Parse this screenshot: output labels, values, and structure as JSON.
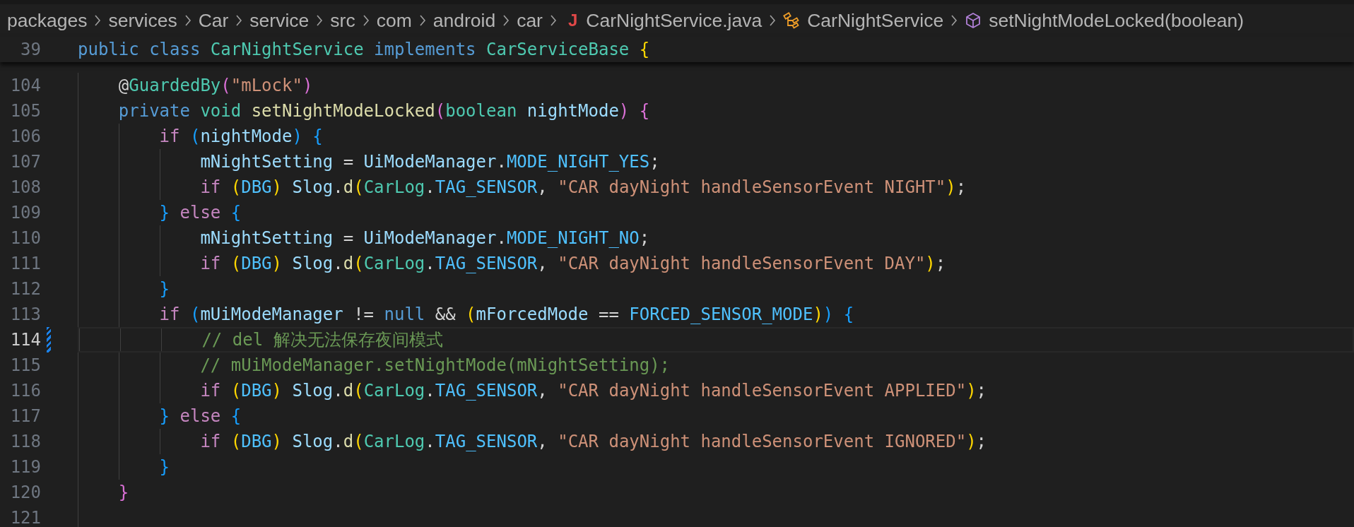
{
  "breadcrumbs": [
    {
      "kind": "folder",
      "label": "packages"
    },
    {
      "kind": "folder",
      "label": "services"
    },
    {
      "kind": "folder",
      "label": "Car"
    },
    {
      "kind": "folder",
      "label": "service"
    },
    {
      "kind": "folder",
      "label": "src"
    },
    {
      "kind": "folder",
      "label": "com"
    },
    {
      "kind": "folder",
      "label": "android"
    },
    {
      "kind": "folder",
      "label": "car"
    },
    {
      "kind": "file",
      "icon_text": "J",
      "label": "CarNightService.java"
    },
    {
      "kind": "class",
      "label": "CarNightService"
    },
    {
      "kind": "method",
      "label": "setNightModeLocked(boolean)"
    }
  ],
  "sticky_line": {
    "number": "39",
    "tokens": [
      {
        "kind": "keyword",
        "text": "public"
      },
      {
        "kind": "keyword",
        "text": " class"
      },
      {
        "kind": "type",
        "text": " CarNightService"
      },
      {
        "kind": "keyword",
        "text": " implements"
      },
      {
        "kind": "type",
        "text": " CarServiceBase"
      },
      {
        "kind": "bracket1",
        "text": " {"
      }
    ]
  },
  "lines": [
    {
      "number": "104",
      "current": false,
      "modified": false,
      "tokens": [
        {
          "kind": "plain",
          "text": "    @"
        },
        {
          "kind": "type",
          "text": "GuardedBy"
        },
        {
          "kind": "bracket2",
          "text": "("
        },
        {
          "kind": "string",
          "text": "\"mLock\""
        },
        {
          "kind": "bracket2",
          "text": ")"
        }
      ]
    },
    {
      "number": "105",
      "current": false,
      "modified": false,
      "tokens": [
        {
          "kind": "keyword",
          "text": "    private"
        },
        {
          "kind": "type",
          "text": " void"
        },
        {
          "kind": "function",
          "text": " setNightModeLocked"
        },
        {
          "kind": "bracket2",
          "text": "("
        },
        {
          "kind": "type",
          "text": "boolean"
        },
        {
          "kind": "variable",
          "text": " nightMode"
        },
        {
          "kind": "bracket2",
          "text": ")"
        },
        {
          "kind": "bracket2",
          "text": " {"
        }
      ]
    },
    {
      "number": "106",
      "current": false,
      "modified": false,
      "tokens": [
        {
          "kind": "control",
          "text": "        if"
        },
        {
          "kind": "bracket3",
          "text": " ("
        },
        {
          "kind": "variable",
          "text": "nightMode"
        },
        {
          "kind": "bracket3",
          "text": ")"
        },
        {
          "kind": "bracket3",
          "text": " {"
        }
      ]
    },
    {
      "number": "107",
      "current": false,
      "modified": false,
      "tokens": [
        {
          "kind": "variable",
          "text": "            mNightSetting"
        },
        {
          "kind": "plain",
          "text": " = "
        },
        {
          "kind": "variable",
          "text": "UiModeManager"
        },
        {
          "kind": "plain",
          "text": "."
        },
        {
          "kind": "constant",
          "text": "MODE_NIGHT_YES"
        },
        {
          "kind": "plain",
          "text": ";"
        }
      ]
    },
    {
      "number": "108",
      "current": false,
      "modified": false,
      "tokens": [
        {
          "kind": "control",
          "text": "            if"
        },
        {
          "kind": "bracket1",
          "text": " ("
        },
        {
          "kind": "constant",
          "text": "DBG"
        },
        {
          "kind": "bracket1",
          "text": ")"
        },
        {
          "kind": "variable",
          "text": " Slog"
        },
        {
          "kind": "plain",
          "text": "."
        },
        {
          "kind": "function",
          "text": "d"
        },
        {
          "kind": "bracket1",
          "text": "("
        },
        {
          "kind": "type",
          "text": "CarLog"
        },
        {
          "kind": "plain",
          "text": "."
        },
        {
          "kind": "constant",
          "text": "TAG_SENSOR"
        },
        {
          "kind": "plain",
          "text": ","
        },
        {
          "kind": "string",
          "text": " \"CAR dayNight handleSensorEvent NIGHT\""
        },
        {
          "kind": "bracket1",
          "text": ")"
        },
        {
          "kind": "plain",
          "text": ";"
        }
      ]
    },
    {
      "number": "109",
      "current": false,
      "modified": false,
      "tokens": [
        {
          "kind": "bracket3",
          "text": "        }"
        },
        {
          "kind": "control",
          "text": " else"
        },
        {
          "kind": "bracket3",
          "text": " {"
        }
      ]
    },
    {
      "number": "110",
      "current": false,
      "modified": false,
      "tokens": [
        {
          "kind": "variable",
          "text": "            mNightSetting"
        },
        {
          "kind": "plain",
          "text": " = "
        },
        {
          "kind": "variable",
          "text": "UiModeManager"
        },
        {
          "kind": "plain",
          "text": "."
        },
        {
          "kind": "constant",
          "text": "MODE_NIGHT_NO"
        },
        {
          "kind": "plain",
          "text": ";"
        }
      ]
    },
    {
      "number": "111",
      "current": false,
      "modified": false,
      "tokens": [
        {
          "kind": "control",
          "text": "            if"
        },
        {
          "kind": "bracket1",
          "text": " ("
        },
        {
          "kind": "constant",
          "text": "DBG"
        },
        {
          "kind": "bracket1",
          "text": ")"
        },
        {
          "kind": "variable",
          "text": " Slog"
        },
        {
          "kind": "plain",
          "text": "."
        },
        {
          "kind": "function",
          "text": "d"
        },
        {
          "kind": "bracket1",
          "text": "("
        },
        {
          "kind": "type",
          "text": "CarLog"
        },
        {
          "kind": "plain",
          "text": "."
        },
        {
          "kind": "constant",
          "text": "TAG_SENSOR"
        },
        {
          "kind": "plain",
          "text": ","
        },
        {
          "kind": "string",
          "text": " \"CAR dayNight handleSensorEvent DAY\""
        },
        {
          "kind": "bracket1",
          "text": ")"
        },
        {
          "kind": "plain",
          "text": ";"
        }
      ]
    },
    {
      "number": "112",
      "current": false,
      "modified": false,
      "tokens": [
        {
          "kind": "bracket3",
          "text": "        }"
        }
      ]
    },
    {
      "number": "113",
      "current": false,
      "modified": false,
      "tokens": [
        {
          "kind": "control",
          "text": "        if"
        },
        {
          "kind": "bracket3",
          "text": " ("
        },
        {
          "kind": "variable",
          "text": "mUiModeManager"
        },
        {
          "kind": "plain",
          "text": " != "
        },
        {
          "kind": "keyword",
          "text": "null"
        },
        {
          "kind": "plain",
          "text": " && "
        },
        {
          "kind": "bracket1",
          "text": "("
        },
        {
          "kind": "variable",
          "text": "mForcedMode"
        },
        {
          "kind": "plain",
          "text": " == "
        },
        {
          "kind": "constant",
          "text": "FORCED_SENSOR_MODE"
        },
        {
          "kind": "bracket1",
          "text": ")"
        },
        {
          "kind": "bracket3",
          "text": ")"
        },
        {
          "kind": "bracket3",
          "text": " {"
        }
      ]
    },
    {
      "number": "114",
      "current": true,
      "modified": true,
      "tokens": [
        {
          "kind": "comment",
          "text": "            // del 解决无法保存夜间模式"
        }
      ]
    },
    {
      "number": "115",
      "current": false,
      "modified": false,
      "tokens": [
        {
          "kind": "comment",
          "text": "            // mUiModeManager.setNightMode(mNightSetting);"
        }
      ]
    },
    {
      "number": "116",
      "current": false,
      "modified": false,
      "tokens": [
        {
          "kind": "control",
          "text": "            if"
        },
        {
          "kind": "bracket1",
          "text": " ("
        },
        {
          "kind": "constant",
          "text": "DBG"
        },
        {
          "kind": "bracket1",
          "text": ")"
        },
        {
          "kind": "variable",
          "text": " Slog"
        },
        {
          "kind": "plain",
          "text": "."
        },
        {
          "kind": "function",
          "text": "d"
        },
        {
          "kind": "bracket1",
          "text": "("
        },
        {
          "kind": "type",
          "text": "CarLog"
        },
        {
          "kind": "plain",
          "text": "."
        },
        {
          "kind": "constant",
          "text": "TAG_SENSOR"
        },
        {
          "kind": "plain",
          "text": ","
        },
        {
          "kind": "string",
          "text": " \"CAR dayNight handleSensorEvent APPLIED\""
        },
        {
          "kind": "bracket1",
          "text": ")"
        },
        {
          "kind": "plain",
          "text": ";"
        }
      ]
    },
    {
      "number": "117",
      "current": false,
      "modified": false,
      "tokens": [
        {
          "kind": "bracket3",
          "text": "        }"
        },
        {
          "kind": "control",
          "text": " else"
        },
        {
          "kind": "bracket3",
          "text": " {"
        }
      ]
    },
    {
      "number": "118",
      "current": false,
      "modified": false,
      "tokens": [
        {
          "kind": "control",
          "text": "            if"
        },
        {
          "kind": "bracket1",
          "text": " ("
        },
        {
          "kind": "constant",
          "text": "DBG"
        },
        {
          "kind": "bracket1",
          "text": ")"
        },
        {
          "kind": "variable",
          "text": " Slog"
        },
        {
          "kind": "plain",
          "text": "."
        },
        {
          "kind": "function",
          "text": "d"
        },
        {
          "kind": "bracket1",
          "text": "("
        },
        {
          "kind": "type",
          "text": "CarLog"
        },
        {
          "kind": "plain",
          "text": "."
        },
        {
          "kind": "constant",
          "text": "TAG_SENSOR"
        },
        {
          "kind": "plain",
          "text": ","
        },
        {
          "kind": "string",
          "text": " \"CAR dayNight handleSensorEvent IGNORED\""
        },
        {
          "kind": "bracket1",
          "text": ")"
        },
        {
          "kind": "plain",
          "text": ";"
        }
      ]
    },
    {
      "number": "119",
      "current": false,
      "modified": false,
      "tokens": [
        {
          "kind": "bracket3",
          "text": "        }"
        }
      ]
    },
    {
      "number": "120",
      "current": false,
      "modified": false,
      "tokens": [
        {
          "kind": "bracket2",
          "text": "    }"
        }
      ]
    },
    {
      "number": "121",
      "current": false,
      "modified": false
    }
  ]
}
